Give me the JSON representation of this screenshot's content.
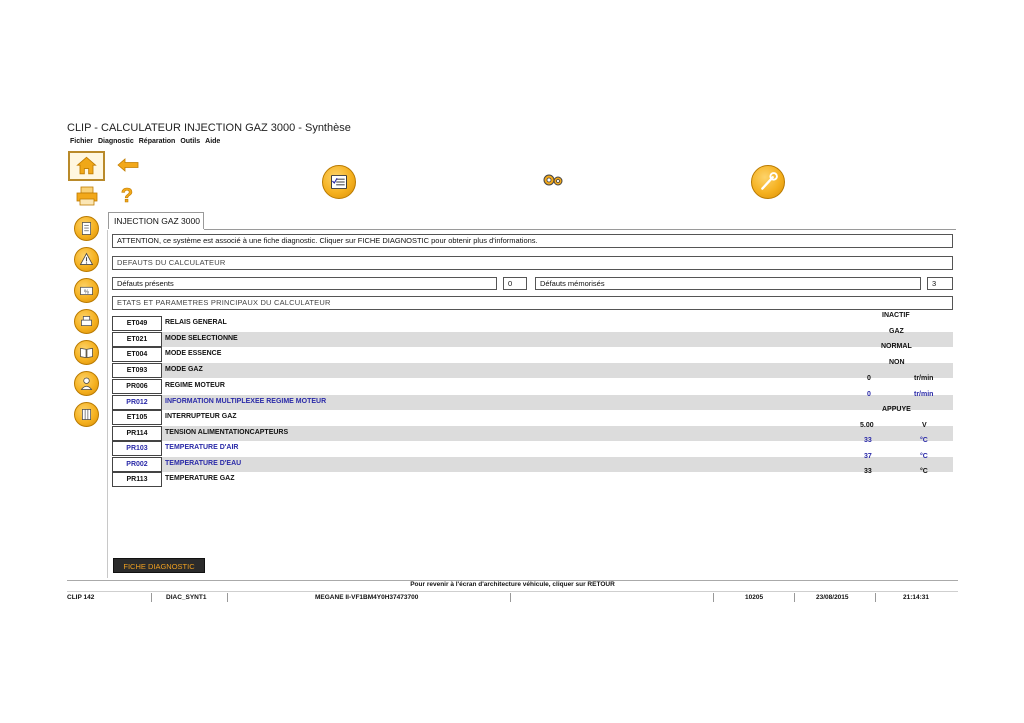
{
  "window": {
    "title": "CLIP - CALCULATEUR INJECTION GAZ 3000 - Synthèse"
  },
  "menu": [
    "Fichier",
    "Diagnostic",
    "Réparation",
    "Outils",
    "Aide"
  ],
  "tab": {
    "label": "INJECTION GAZ 3000"
  },
  "attention": "ATTENTION, ce système est associé à une fiche diagnostic. Cliquer sur FICHE DIAGNOSTIC pour obtenir plus d'informations.",
  "defaults_section": {
    "title": "DEFAUTS DU CALCULATEUR",
    "present_label": "Défauts présents",
    "present_count": "0",
    "memorized_label": "Défauts mémorisés",
    "memorized_count": "3"
  },
  "params_section": {
    "title": "ETATS ET PARAMETRES PRINCIPAUX DU CALCULATEUR"
  },
  "rows": [
    {
      "code": "ET049",
      "label": "RELAIS GENERAL",
      "value": "INACTIF",
      "unit": ""
    },
    {
      "code": "ET021",
      "label": "MODE SELECTIONNE",
      "value": "GAZ",
      "unit": ""
    },
    {
      "code": "ET004",
      "label": "MODE ESSENCE",
      "value": "NORMAL",
      "unit": ""
    },
    {
      "code": "ET093",
      "label": "MODE GAZ",
      "value": "NON",
      "unit": ""
    },
    {
      "code": "PR006",
      "label": "REGIME MOTEUR",
      "value": "0",
      "unit": "tr/min"
    },
    {
      "code": "PR012",
      "label": "INFORMATION MULTIPLEXEE REGIME MOTEUR",
      "value": "0",
      "unit": "tr/min"
    },
    {
      "code": "ET105",
      "label": "INTERRUPTEUR GAZ",
      "value": "APPUYE",
      "unit": ""
    },
    {
      "code": "PR114",
      "label": "TENSION ALIMENTATIONCAPTEURS",
      "value": "5.00",
      "unit": "V"
    },
    {
      "code": "PR103",
      "label": "TEMPERATURE D'AIR",
      "value": "33",
      "unit": "°C"
    },
    {
      "code": "PR002",
      "label": "TEMPERATURE D'EAU",
      "value": "37",
      "unit": "°C"
    },
    {
      "code": "PR113",
      "label": "TEMPERATURE GAZ",
      "value": "33",
      "unit": "°C"
    }
  ],
  "fiche_button": "FICHE DIAGNOSTIC",
  "status": {
    "message": "Pour revenir à l'écran d'architecture véhicule, cliquer sur RETOUR",
    "clip": "CLIP 142",
    "screen": "DIAC_SYNT1",
    "vehicle": "MEGANE II-VF1BM4Y0H37473700",
    "code": "10205",
    "date": "23/08/2015",
    "time": "21:14:31"
  },
  "colors": {
    "accent": "#f5b120",
    "link_blue": "#2a2aa8",
    "row_shade": "#dcdcdc"
  },
  "icons": {
    "top": [
      "home-icon",
      "back-arrow-icon",
      "print-icon",
      "help-icon",
      "checklist-icon",
      "gearbox-icon",
      "wrench-icon"
    ],
    "side": [
      "document-icon",
      "warning-icon",
      "percent-icon",
      "printer-tool-icon",
      "book-icon",
      "mechanic-icon",
      "grid-icon"
    ]
  }
}
